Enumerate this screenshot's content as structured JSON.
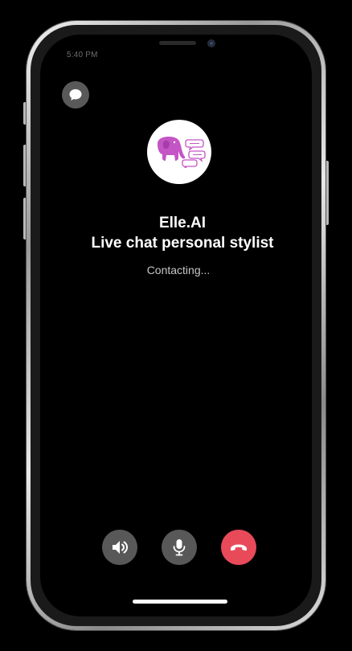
{
  "status_bar": {
    "time": "5:40 PM"
  },
  "call": {
    "caller_name": "Elle.AI",
    "caller_subtitle": "Live chat personal stylist",
    "status": "Contacting..."
  },
  "icons": {
    "chat": "chat-bubble-icon",
    "avatar": "elephant-logo-icon",
    "speaker": "speaker-icon",
    "mic": "microphone-icon",
    "end_call": "end-call-icon"
  },
  "colors": {
    "background": "#000000",
    "button_gray": "#585858",
    "end_call_red": "#e84a5a",
    "logo_purple": "#c455c4",
    "text_primary": "#ffffff",
    "text_secondary": "#c7c7c7"
  }
}
